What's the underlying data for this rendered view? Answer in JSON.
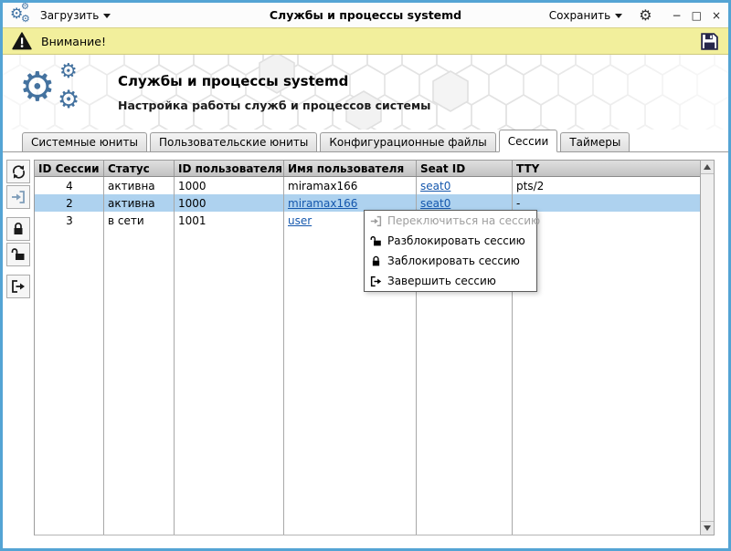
{
  "window": {
    "title": "Службы и процессы systemd",
    "load_label": "Загрузить",
    "save_label": "Сохранить",
    "controls": {
      "minimize": "−",
      "maximize": "□",
      "close": "×"
    }
  },
  "warning": {
    "text": "Внимание!"
  },
  "hero": {
    "title": "Службы и процессы systemd",
    "subtitle": "Настройка работы служб и процессов системы"
  },
  "tabs": [
    {
      "label": "Системные юниты",
      "active": false
    },
    {
      "label": "Пользовательские юниты",
      "active": false
    },
    {
      "label": "Конфигурационные файлы",
      "active": false
    },
    {
      "label": "Сессии",
      "active": true
    },
    {
      "label": "Таймеры",
      "active": false
    }
  ],
  "toolbar": [
    {
      "icon": "refresh-icon",
      "disabled": false
    },
    {
      "icon": "switch-to-session-icon",
      "disabled": true
    },
    {
      "icon": "lock-session-icon",
      "disabled": false
    },
    {
      "icon": "unlock-session-icon",
      "disabled": false
    },
    {
      "icon": "end-session-icon",
      "disabled": false
    }
  ],
  "table": {
    "columns": [
      "ID Сессии",
      "Статус",
      "ID пользователя",
      "Имя пользователя",
      "Seat ID",
      "TTY"
    ],
    "rows": [
      {
        "selected": false,
        "cells": [
          {
            "text": "4",
            "link": false
          },
          {
            "text": "активна",
            "link": false
          },
          {
            "text": "1000",
            "link": false
          },
          {
            "text": "miramax166",
            "link": false
          },
          {
            "text": "seat0",
            "link": true
          },
          {
            "text": "pts/2",
            "link": false
          }
        ]
      },
      {
        "selected": true,
        "cells": [
          {
            "text": "2",
            "link": false
          },
          {
            "text": "активна",
            "link": false
          },
          {
            "text": "1000",
            "link": false
          },
          {
            "text": "miramax166",
            "link": true
          },
          {
            "text": "seat0",
            "link": true
          },
          {
            "text": "-",
            "link": false
          }
        ]
      },
      {
        "selected": false,
        "cells": [
          {
            "text": "3",
            "link": false
          },
          {
            "text": "в сети",
            "link": false
          },
          {
            "text": "1001",
            "link": false
          },
          {
            "text": "user",
            "link": true
          },
          {
            "text": "",
            "link": false
          },
          {
            "text": "",
            "link": false
          }
        ]
      }
    ]
  },
  "context_menu": {
    "items": [
      {
        "label": "Переключиться на сессию",
        "icon": "switch-to-session-icon",
        "disabled": true
      },
      {
        "label": "Разблокировать сессию",
        "icon": "unlock-session-icon",
        "disabled": false
      },
      {
        "label": "Заблокировать сессию",
        "icon": "lock-session-icon",
        "disabled": false
      },
      {
        "label": "Завершить сессию",
        "icon": "end-session-icon",
        "disabled": false
      }
    ]
  },
  "colors": {
    "window_border": "#54a4d4",
    "accent_blue": "#44729f",
    "selection": "#aed2ef",
    "warning_bg": "#f2ef9c",
    "link": "#1457ad",
    "table_header_bg": "#c9c9c9"
  }
}
